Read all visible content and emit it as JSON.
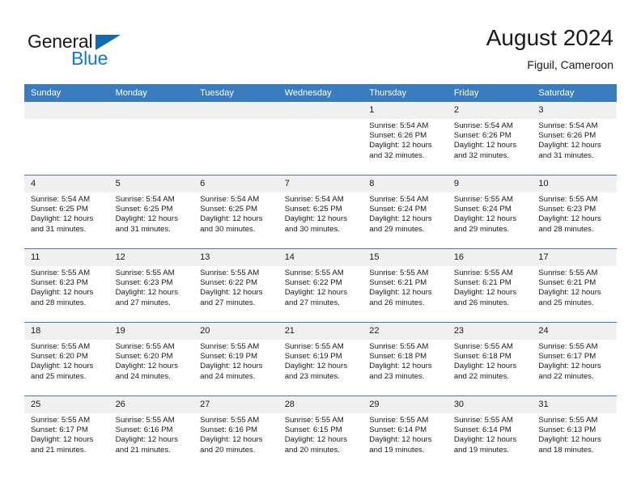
{
  "brand": {
    "name_part1": "General",
    "name_part2": "Blue",
    "triangle_color": "#1169b0",
    "blue_color": "#1477c8"
  },
  "header": {
    "title": "August 2024",
    "subtitle": "Figuil, Cameroon"
  },
  "theme": {
    "header_blue": "#3a7cbe",
    "daynum_gray": "#f0f0f0",
    "text": "#1a1a1a"
  },
  "weekdays": [
    "Sunday",
    "Monday",
    "Tuesday",
    "Wednesday",
    "Thursday",
    "Friday",
    "Saturday"
  ],
  "labels": {
    "sunrise_prefix": "Sunrise:",
    "sunset_prefix": "Sunset:",
    "daylight_prefix": "Daylight:"
  },
  "weeks": [
    [
      {
        "day": "",
        "line1": "",
        "line2": "",
        "line3": "",
        "line4": ""
      },
      {
        "day": "",
        "line1": "",
        "line2": "",
        "line3": "",
        "line4": ""
      },
      {
        "day": "",
        "line1": "",
        "line2": "",
        "line3": "",
        "line4": ""
      },
      {
        "day": "",
        "line1": "",
        "line2": "",
        "line3": "",
        "line4": ""
      },
      {
        "day": "1",
        "line1": "Sunrise: 5:54 AM",
        "line2": "Sunset: 6:26 PM",
        "line3": "Daylight: 12 hours",
        "line4": "and 32 minutes."
      },
      {
        "day": "2",
        "line1": "Sunrise: 5:54 AM",
        "line2": "Sunset: 6:26 PM",
        "line3": "Daylight: 12 hours",
        "line4": "and 32 minutes."
      },
      {
        "day": "3",
        "line1": "Sunrise: 5:54 AM",
        "line2": "Sunset: 6:26 PM",
        "line3": "Daylight: 12 hours",
        "line4": "and 31 minutes."
      }
    ],
    [
      {
        "day": "4",
        "line1": "Sunrise: 5:54 AM",
        "line2": "Sunset: 6:25 PM",
        "line3": "Daylight: 12 hours",
        "line4": "and 31 minutes."
      },
      {
        "day": "5",
        "line1": "Sunrise: 5:54 AM",
        "line2": "Sunset: 6:25 PM",
        "line3": "Daylight: 12 hours",
        "line4": "and 31 minutes."
      },
      {
        "day": "6",
        "line1": "Sunrise: 5:54 AM",
        "line2": "Sunset: 6:25 PM",
        "line3": "Daylight: 12 hours",
        "line4": "and 30 minutes."
      },
      {
        "day": "7",
        "line1": "Sunrise: 5:54 AM",
        "line2": "Sunset: 6:25 PM",
        "line3": "Daylight: 12 hours",
        "line4": "and 30 minutes."
      },
      {
        "day": "8",
        "line1": "Sunrise: 5:54 AM",
        "line2": "Sunset: 6:24 PM",
        "line3": "Daylight: 12 hours",
        "line4": "and 29 minutes."
      },
      {
        "day": "9",
        "line1": "Sunrise: 5:55 AM",
        "line2": "Sunset: 6:24 PM",
        "line3": "Daylight: 12 hours",
        "line4": "and 29 minutes."
      },
      {
        "day": "10",
        "line1": "Sunrise: 5:55 AM",
        "line2": "Sunset: 6:23 PM",
        "line3": "Daylight: 12 hours",
        "line4": "and 28 minutes."
      }
    ],
    [
      {
        "day": "11",
        "line1": "Sunrise: 5:55 AM",
        "line2": "Sunset: 6:23 PM",
        "line3": "Daylight: 12 hours",
        "line4": "and 28 minutes."
      },
      {
        "day": "12",
        "line1": "Sunrise: 5:55 AM",
        "line2": "Sunset: 6:23 PM",
        "line3": "Daylight: 12 hours",
        "line4": "and 27 minutes."
      },
      {
        "day": "13",
        "line1": "Sunrise: 5:55 AM",
        "line2": "Sunset: 6:22 PM",
        "line3": "Daylight: 12 hours",
        "line4": "and 27 minutes."
      },
      {
        "day": "14",
        "line1": "Sunrise: 5:55 AM",
        "line2": "Sunset: 6:22 PM",
        "line3": "Daylight: 12 hours",
        "line4": "and 27 minutes."
      },
      {
        "day": "15",
        "line1": "Sunrise: 5:55 AM",
        "line2": "Sunset: 6:21 PM",
        "line3": "Daylight: 12 hours",
        "line4": "and 26 minutes."
      },
      {
        "day": "16",
        "line1": "Sunrise: 5:55 AM",
        "line2": "Sunset: 6:21 PM",
        "line3": "Daylight: 12 hours",
        "line4": "and 26 minutes."
      },
      {
        "day": "17",
        "line1": "Sunrise: 5:55 AM",
        "line2": "Sunset: 6:21 PM",
        "line3": "Daylight: 12 hours",
        "line4": "and 25 minutes."
      }
    ],
    [
      {
        "day": "18",
        "line1": "Sunrise: 5:55 AM",
        "line2": "Sunset: 6:20 PM",
        "line3": "Daylight: 12 hours",
        "line4": "and 25 minutes."
      },
      {
        "day": "19",
        "line1": "Sunrise: 5:55 AM",
        "line2": "Sunset: 6:20 PM",
        "line3": "Daylight: 12 hours",
        "line4": "and 24 minutes."
      },
      {
        "day": "20",
        "line1": "Sunrise: 5:55 AM",
        "line2": "Sunset: 6:19 PM",
        "line3": "Daylight: 12 hours",
        "line4": "and 24 minutes."
      },
      {
        "day": "21",
        "line1": "Sunrise: 5:55 AM",
        "line2": "Sunset: 6:19 PM",
        "line3": "Daylight: 12 hours",
        "line4": "and 23 minutes."
      },
      {
        "day": "22",
        "line1": "Sunrise: 5:55 AM",
        "line2": "Sunset: 6:18 PM",
        "line3": "Daylight: 12 hours",
        "line4": "and 23 minutes."
      },
      {
        "day": "23",
        "line1": "Sunrise: 5:55 AM",
        "line2": "Sunset: 6:18 PM",
        "line3": "Daylight: 12 hours",
        "line4": "and 22 minutes."
      },
      {
        "day": "24",
        "line1": "Sunrise: 5:55 AM",
        "line2": "Sunset: 6:17 PM",
        "line3": "Daylight: 12 hours",
        "line4": "and 22 minutes."
      }
    ],
    [
      {
        "day": "25",
        "line1": "Sunrise: 5:55 AM",
        "line2": "Sunset: 6:17 PM",
        "line3": "Daylight: 12 hours",
        "line4": "and 21 minutes."
      },
      {
        "day": "26",
        "line1": "Sunrise: 5:55 AM",
        "line2": "Sunset: 6:16 PM",
        "line3": "Daylight: 12 hours",
        "line4": "and 21 minutes."
      },
      {
        "day": "27",
        "line1": "Sunrise: 5:55 AM",
        "line2": "Sunset: 6:16 PM",
        "line3": "Daylight: 12 hours",
        "line4": "and 20 minutes."
      },
      {
        "day": "28",
        "line1": "Sunrise: 5:55 AM",
        "line2": "Sunset: 6:15 PM",
        "line3": "Daylight: 12 hours",
        "line4": "and 20 minutes."
      },
      {
        "day": "29",
        "line1": "Sunrise: 5:55 AM",
        "line2": "Sunset: 6:14 PM",
        "line3": "Daylight: 12 hours",
        "line4": "and 19 minutes."
      },
      {
        "day": "30",
        "line1": "Sunrise: 5:55 AM",
        "line2": "Sunset: 6:14 PM",
        "line3": "Daylight: 12 hours",
        "line4": "and 19 minutes."
      },
      {
        "day": "31",
        "line1": "Sunrise: 5:55 AM",
        "line2": "Sunset: 6:13 PM",
        "line3": "Daylight: 12 hours",
        "line4": "and 18 minutes."
      }
    ]
  ]
}
